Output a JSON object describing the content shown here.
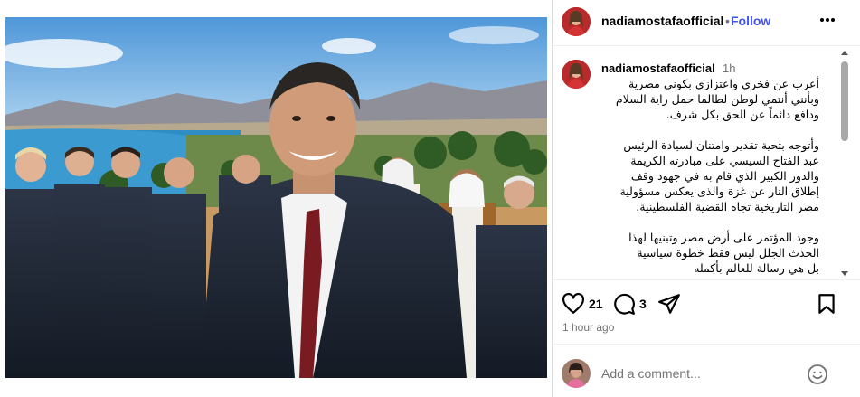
{
  "post": {
    "username": "nadiamostafaofficial",
    "separator": "•",
    "follow_label": "Follow",
    "more_icon": "more-horizontal-icon",
    "caption": {
      "username": "nadiamostafaofficial",
      "time": "1h",
      "text": "أعرب عن فخري واعتزازي بكوني مصرية\nوبأنني أنتمي لوطن لطالما حمل راية السلام\nودافع  دائماً عن الحق بكل شرف.\n\nوأتوجه بتحية تقدير وامتنان لسيادة الرئيس\nعبد الفتاح السيسي على مبادرته الكريمة\nوالدور الكبير الذي قام به في جهود وقف\nإطلاق النار عن غزة والذى يعكس مسؤولية\nمصر التاريخية تجاه القضية الفلسطينية.\n\nوجود المؤتمر على أرض مصر وتبنيها لهذا\nالحدث الجلل ليس فقط خطوة سياسية\nبل هي رسالة للعالم بأكمله"
    },
    "actions": {
      "like_icon": "heart-icon",
      "like_count": "21",
      "comment_icon": "comment-bubble-icon",
      "comment_count": "3",
      "share_icon": "paper-plane-icon",
      "save_icon": "bookmark-icon",
      "time_ago": "1 hour ago"
    },
    "add_comment": {
      "placeholder": "Add a comment...",
      "emoji_icon": "smiley-icon"
    }
  },
  "colors": {
    "follow_blue": "#4150f7",
    "muted_text": "#737373",
    "border": "#dbdbdb",
    "avatar_red": "#c62a2a"
  }
}
